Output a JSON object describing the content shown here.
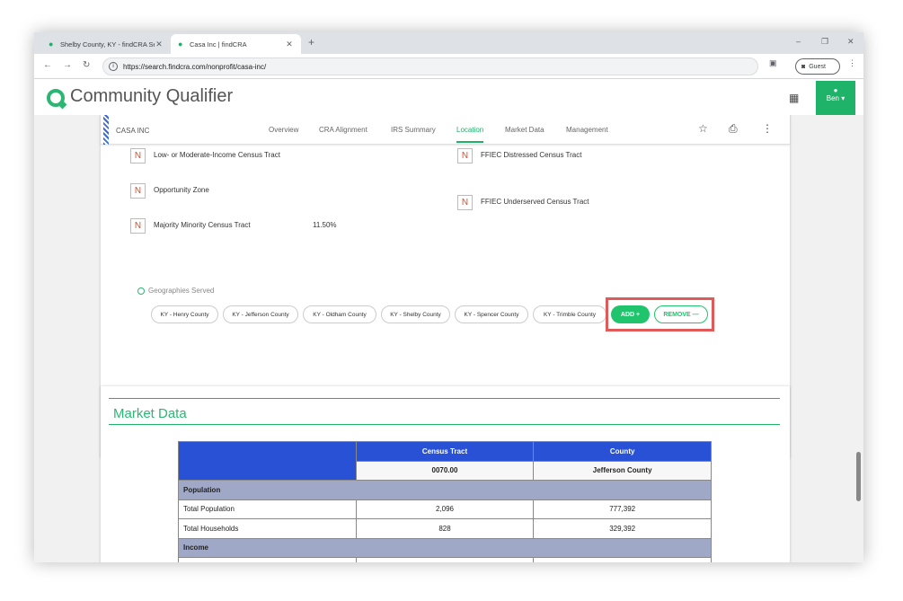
{
  "browser": {
    "tabs": [
      {
        "title": "Shelby County, KY - findCRA Se",
        "active": false
      },
      {
        "title": "Casa Inc | findCRA",
        "active": true
      }
    ],
    "new_tab": "+",
    "url": "https://search.findcra.com/nonprofit/casa-inc/",
    "profile": "Guest",
    "window_controls": [
      "–",
      "❐",
      "✕"
    ]
  },
  "app": {
    "brand": "Community Qualifier",
    "user": "Ben"
  },
  "subnav": {
    "org": "CASA INC",
    "items": [
      "Overview",
      "CRA Alignment",
      "IRS Summary",
      "Location",
      "Market Data",
      "Management"
    ],
    "active": "Location"
  },
  "flags": {
    "left": [
      {
        "box": "N",
        "label": "Low- or Moderate-Income Census Tract",
        "value": ""
      },
      {
        "box": "N",
        "label": "Opportunity Zone",
        "value": ""
      },
      {
        "box": "N",
        "label": "Majority Minority Census Tract",
        "value": "11.50%"
      }
    ],
    "right": [
      {
        "box": "N",
        "label": "FFIEC Distressed Census Tract"
      },
      {
        "box": "N",
        "label": "FFIEC Underserved Census Tract"
      }
    ]
  },
  "geographies": {
    "title": "Geographies Served",
    "chips": [
      "KY - Henry County",
      "KY - Jefferson County",
      "KY - Oldham County",
      "KY - Shelby County",
      "KY - Spencer County",
      "KY - Trimble County"
    ],
    "add_label": "ADD  +",
    "remove_label": "REMOVE  —"
  },
  "market": {
    "title": "Market Data",
    "headers": [
      "Census Tract",
      "County"
    ],
    "subheaders": [
      "0070.00",
      "Jefferson County"
    ],
    "sections": [
      {
        "name": "Population",
        "rows": [
          {
            "label": "Total Population",
            "tract": "2,096",
            "county": "777,392"
          },
          {
            "label": "Total Households",
            "tract": "828",
            "county": "329,392"
          }
        ]
      },
      {
        "name": "Income",
        "rows": []
      }
    ]
  },
  "colors": {
    "brand_green": "#1fb36a",
    "table_header_blue": "#2951d6",
    "highlight_red": "#e05a5a"
  }
}
